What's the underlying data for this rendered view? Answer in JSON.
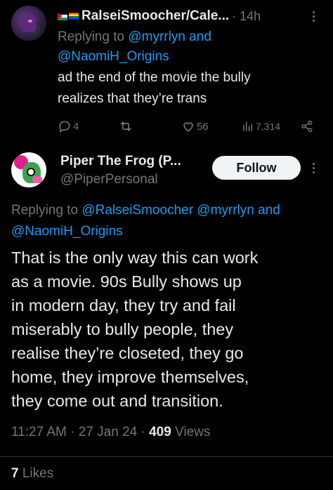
{
  "reply_tweet": {
    "display_name": "RalseiSmoocher/Cale...",
    "time": "· 14h",
    "replying_prefix": "Replying to",
    "replying_handle_1": "@myrrlyn and",
    "replying_handle_2": "@NaomiH_Origins",
    "text_line_1": "ad the end of the movie the bully",
    "text_line_2": "realizes that they’re trans",
    "replies": "4",
    "likes": "56",
    "views": "7,314"
  },
  "main_tweet": {
    "display_name": "Piper The Frog (P...",
    "handle": "@PiperPersonal",
    "follow_label": "Follow",
    "replying_prefix": "Replying to",
    "replying_handles_line1": "@RalseiSmoocher @myrrlyn and",
    "replying_handles_line2": "@NaomiH_Origins",
    "text_lines": [
      "That is the only way this can work",
      "as a movie. 90s Bully shows up",
      "in modern day, they try and fail",
      "miserably to bully people, they",
      "realise they’re closeted, they go",
      "home, they improve themselves,",
      "they come out and transition."
    ],
    "timestamp": "11:27 AM · 27 Jan 24 ·",
    "views_count": "409",
    "views_label": "Views",
    "likes_count": "7",
    "likes_label": "Likes"
  },
  "colors": {
    "background": "#000000",
    "text": "#e7e9ea",
    "muted": "#71767b",
    "link": "#1d9bf0",
    "divider": "#2f3336"
  }
}
